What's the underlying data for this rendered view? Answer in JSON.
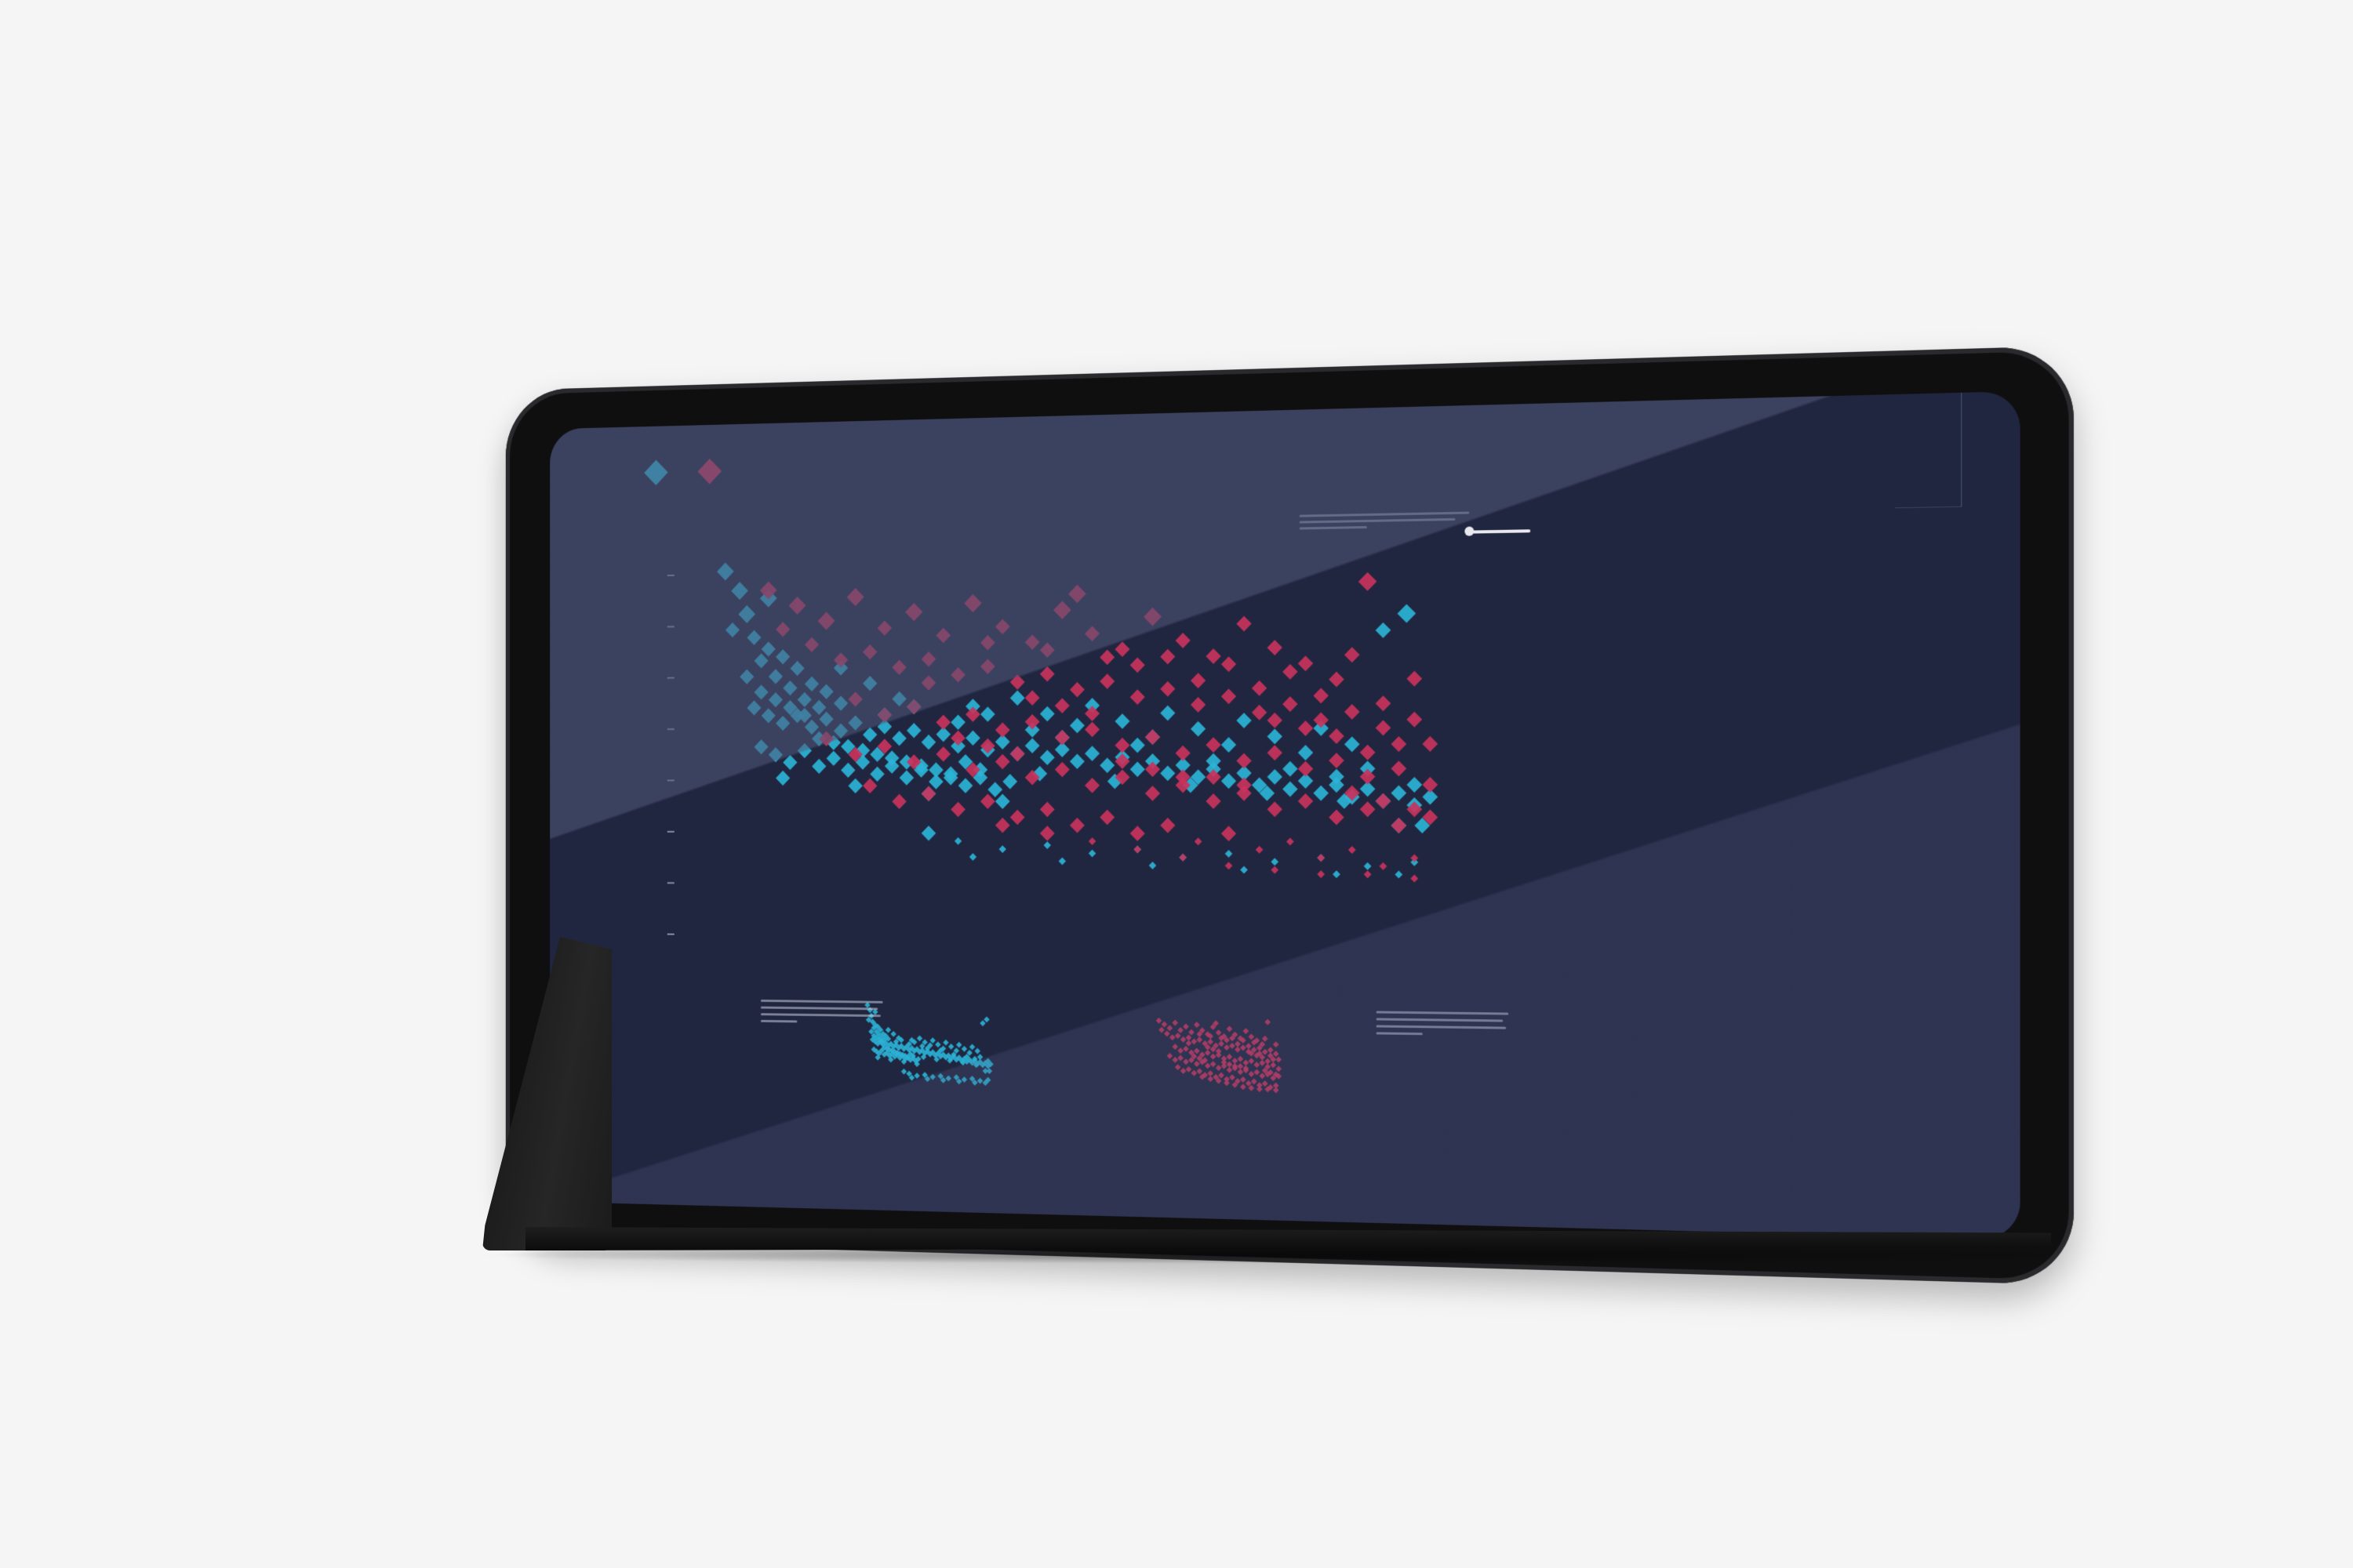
{
  "colors": {
    "background": "#f5f5f5",
    "screen": "#212640",
    "series_a": "#2bb3d6",
    "series_b": "#c8335c",
    "text": "#d8dbe6"
  },
  "legend": {
    "items": [
      {
        "label": "",
        "color": "#2bb3d6"
      },
      {
        "label": "",
        "color": "#c8335c"
      }
    ]
  },
  "intro_text": "",
  "caption_left": "",
  "caption_right": "",
  "chart_data": {
    "type": "scatter",
    "marker": "diamond",
    "title": "",
    "xlabel": "",
    "ylabel": "",
    "xlim": [
      0,
      100
    ],
    "ylim": [
      0,
      100
    ],
    "grid": false,
    "legend_position": "top-left",
    "y_ticks": [
      "",
      "",
      "",
      "",
      "",
      "",
      "",
      ""
    ],
    "series": [
      {
        "color": "#2bb3d6",
        "points": [
          [
            2,
            95
          ],
          [
            4,
            90
          ],
          [
            5,
            84
          ],
          [
            3,
            80
          ],
          [
            6,
            78
          ],
          [
            8,
            75
          ],
          [
            7,
            72
          ],
          [
            10,
            73
          ],
          [
            9,
            68
          ],
          [
            12,
            70
          ],
          [
            11,
            65
          ],
          [
            14,
            66
          ],
          [
            13,
            62
          ],
          [
            16,
            64
          ],
          [
            15,
            60
          ],
          [
            18,
            61
          ],
          [
            6,
            60
          ],
          [
            8,
            58
          ],
          [
            10,
            56
          ],
          [
            12,
            58
          ],
          [
            14,
            55
          ],
          [
            16,
            57
          ],
          [
            18,
            54
          ],
          [
            20,
            56
          ],
          [
            22,
            53
          ],
          [
            24,
            55
          ],
          [
            26,
            52
          ],
          [
            28,
            54
          ],
          [
            30,
            51
          ],
          [
            32,
            53
          ],
          [
            34,
            50
          ],
          [
            36,
            52
          ],
          [
            38,
            49
          ],
          [
            40,
            51
          ],
          [
            42,
            48
          ],
          [
            44,
            50
          ],
          [
            46,
            47
          ],
          [
            48,
            49
          ],
          [
            50,
            46
          ],
          [
            52,
            48
          ],
          [
            54,
            45
          ],
          [
            56,
            47
          ],
          [
            58,
            44
          ],
          [
            60,
            46
          ],
          [
            62,
            43
          ],
          [
            64,
            45
          ],
          [
            66,
            42
          ],
          [
            68,
            44
          ],
          [
            70,
            41
          ],
          [
            72,
            43
          ],
          [
            74,
            40
          ],
          [
            76,
            42
          ],
          [
            78,
            39
          ],
          [
            80,
            41
          ],
          [
            82,
            38
          ],
          [
            84,
            40
          ],
          [
            86,
            37
          ],
          [
            88,
            39
          ],
          [
            90,
            36
          ],
          [
            92,
            38
          ],
          [
            94,
            35
          ],
          [
            96,
            37
          ],
          [
            7,
            50
          ],
          [
            9,
            48
          ],
          [
            11,
            46
          ],
          [
            13,
            49
          ],
          [
            15,
            45
          ],
          [
            17,
            47
          ],
          [
            19,
            44
          ],
          [
            21,
            46
          ],
          [
            23,
            43
          ],
          [
            25,
            45
          ],
          [
            27,
            42
          ],
          [
            29,
            44
          ],
          [
            31,
            41
          ],
          [
            33,
            43
          ],
          [
            35,
            40
          ],
          [
            37,
            42
          ],
          [
            39,
            39
          ],
          [
            41,
            41
          ],
          [
            5,
            68
          ],
          [
            7,
            64
          ],
          [
            9,
            62
          ],
          [
            11,
            60
          ],
          [
            13,
            58
          ],
          [
            15,
            52
          ],
          [
            17,
            51
          ],
          [
            19,
            50
          ],
          [
            21,
            49
          ],
          [
            23,
            48
          ],
          [
            25,
            47
          ],
          [
            27,
            46
          ],
          [
            29,
            45
          ],
          [
            31,
            44
          ],
          [
            33,
            42
          ],
          [
            35,
            46
          ],
          [
            37,
            44
          ],
          [
            45,
            43
          ],
          [
            55,
            41
          ],
          [
            65,
            40
          ],
          [
            75,
            38
          ],
          [
            85,
            36
          ],
          [
            95,
            30
          ],
          [
            50,
            55
          ],
          [
            60,
            52
          ],
          [
            70,
            50
          ],
          [
            80,
            48
          ],
          [
            88,
            44
          ],
          [
            92,
            30
          ],
          [
            20,
            40
          ],
          [
            30,
            38
          ],
          [
            40,
            36
          ],
          [
            10,
            42
          ],
          [
            24,
            58
          ],
          [
            34,
            56
          ],
          [
            44,
            54
          ],
          [
            90,
            78
          ],
          [
            93,
            82
          ],
          [
            8,
            88
          ],
          [
            26,
            62
          ],
          [
            36,
            60
          ],
          [
            46,
            58
          ],
          [
            56,
            56
          ],
          [
            66,
            54
          ],
          [
            76,
            52
          ],
          [
            86,
            50
          ],
          [
            18,
            70
          ],
          [
            22,
            66
          ],
          [
            28,
            60
          ],
          [
            38,
            58
          ],
          [
            48,
            52
          ],
          [
            58,
            50
          ],
          [
            68,
            46
          ],
          [
            78,
            44
          ],
          [
            84,
            42
          ],
          [
            94,
            40
          ],
          [
            42,
            62
          ],
          [
            52,
            60
          ],
          [
            62,
            58
          ],
          [
            72,
            56
          ],
          [
            82,
            54
          ],
          [
            30,
            28
          ],
          [
            34,
            26
          ],
          [
            40,
            24
          ],
          [
            46,
            25
          ],
          [
            52,
            23
          ],
          [
            58,
            24
          ],
          [
            64,
            22
          ],
          [
            70,
            23
          ],
          [
            76,
            21
          ],
          [
            82,
            22
          ],
          [
            88,
            20
          ],
          [
            94,
            21
          ],
          [
            36,
            22
          ],
          [
            48,
            21
          ],
          [
            60,
            20
          ],
          [
            72,
            19
          ],
          [
            84,
            18
          ],
          [
            92,
            18
          ]
        ]
      },
      {
        "color": "#c8335c",
        "points": [
          [
            8,
            90
          ],
          [
            12,
            86
          ],
          [
            16,
            82
          ],
          [
            20,
            88
          ],
          [
            24,
            80
          ],
          [
            28,
            84
          ],
          [
            32,
            78
          ],
          [
            36,
            86
          ],
          [
            40,
            80
          ],
          [
            44,
            76
          ],
          [
            48,
            84
          ],
          [
            52,
            78
          ],
          [
            56,
            74
          ],
          [
            60,
            82
          ],
          [
            64,
            76
          ],
          [
            68,
            72
          ],
          [
            72,
            80
          ],
          [
            76,
            74
          ],
          [
            80,
            70
          ],
          [
            84,
            66
          ],
          [
            88,
            90
          ],
          [
            14,
            76
          ],
          [
            18,
            72
          ],
          [
            22,
            74
          ],
          [
            26,
            70
          ],
          [
            30,
            72
          ],
          [
            34,
            68
          ],
          [
            38,
            70
          ],
          [
            42,
            66
          ],
          [
            46,
            68
          ],
          [
            50,
            64
          ],
          [
            54,
            66
          ],
          [
            58,
            62
          ],
          [
            62,
            64
          ],
          [
            66,
            60
          ],
          [
            70,
            62
          ],
          [
            74,
            58
          ],
          [
            78,
            60
          ],
          [
            82,
            56
          ],
          [
            86,
            58
          ],
          [
            90,
            54
          ],
          [
            94,
            56
          ],
          [
            96,
            50
          ],
          [
            20,
            62
          ],
          [
            24,
            58
          ],
          [
            28,
            60
          ],
          [
            32,
            56
          ],
          [
            36,
            58
          ],
          [
            40,
            54
          ],
          [
            44,
            56
          ],
          [
            48,
            52
          ],
          [
            52,
            54
          ],
          [
            56,
            50
          ],
          [
            60,
            52
          ],
          [
            64,
            48
          ],
          [
            68,
            50
          ],
          [
            72,
            46
          ],
          [
            76,
            48
          ],
          [
            80,
            44
          ],
          [
            84,
            46
          ],
          [
            88,
            42
          ],
          [
            92,
            44
          ],
          [
            96,
            40
          ],
          [
            16,
            52
          ],
          [
            20,
            48
          ],
          [
            24,
            50
          ],
          [
            28,
            46
          ],
          [
            32,
            48
          ],
          [
            36,
            44
          ],
          [
            40,
            46
          ],
          [
            44,
            42
          ],
          [
            48,
            44
          ],
          [
            52,
            40
          ],
          [
            56,
            42
          ],
          [
            60,
            38
          ],
          [
            64,
            40
          ],
          [
            68,
            36
          ],
          [
            72,
            38
          ],
          [
            76,
            34
          ],
          [
            80,
            36
          ],
          [
            84,
            32
          ],
          [
            88,
            34
          ],
          [
            92,
            30
          ],
          [
            96,
            32
          ],
          [
            22,
            40
          ],
          [
            26,
            36
          ],
          [
            30,
            38
          ],
          [
            34,
            34
          ],
          [
            38,
            36
          ],
          [
            42,
            32
          ],
          [
            46,
            34
          ],
          [
            50,
            30
          ],
          [
            54,
            32
          ],
          [
            58,
            28
          ],
          [
            62,
            30
          ],
          [
            66,
            26
          ],
          [
            70,
            28
          ],
          [
            74,
            24
          ],
          [
            78,
            26
          ],
          [
            82,
            22
          ],
          [
            86,
            24
          ],
          [
            90,
            20
          ],
          [
            94,
            22
          ],
          [
            10,
            80
          ],
          [
            50,
            88
          ],
          [
            58,
            70
          ],
          [
            66,
            66
          ],
          [
            74,
            64
          ],
          [
            82,
            62
          ],
          [
            90,
            60
          ],
          [
            94,
            66
          ],
          [
            86,
            72
          ],
          [
            78,
            68
          ],
          [
            70,
            70
          ],
          [
            62,
            72
          ],
          [
            54,
            72
          ],
          [
            46,
            74
          ],
          [
            38,
            76
          ],
          [
            30,
            66
          ],
          [
            92,
            50
          ],
          [
            88,
            48
          ],
          [
            84,
            52
          ],
          [
            80,
            54
          ],
          [
            76,
            56
          ],
          [
            44,
            62
          ],
          [
            48,
            60
          ],
          [
            52,
            58
          ],
          [
            56,
            46
          ],
          [
            60,
            44
          ],
          [
            64,
            42
          ],
          [
            68,
            42
          ],
          [
            72,
            40
          ],
          [
            86,
            38
          ],
          [
            90,
            36
          ],
          [
            94,
            34
          ],
          [
            34,
            52
          ],
          [
            38,
            50
          ],
          [
            42,
            48
          ],
          [
            40,
            30
          ],
          [
            46,
            28
          ],
          [
            52,
            26
          ],
          [
            58,
            24
          ],
          [
            64,
            22
          ],
          [
            70,
            20
          ],
          [
            76,
            19
          ],
          [
            82,
            18
          ],
          [
            88,
            18
          ],
          [
            94,
            17
          ]
        ]
      }
    ]
  }
}
